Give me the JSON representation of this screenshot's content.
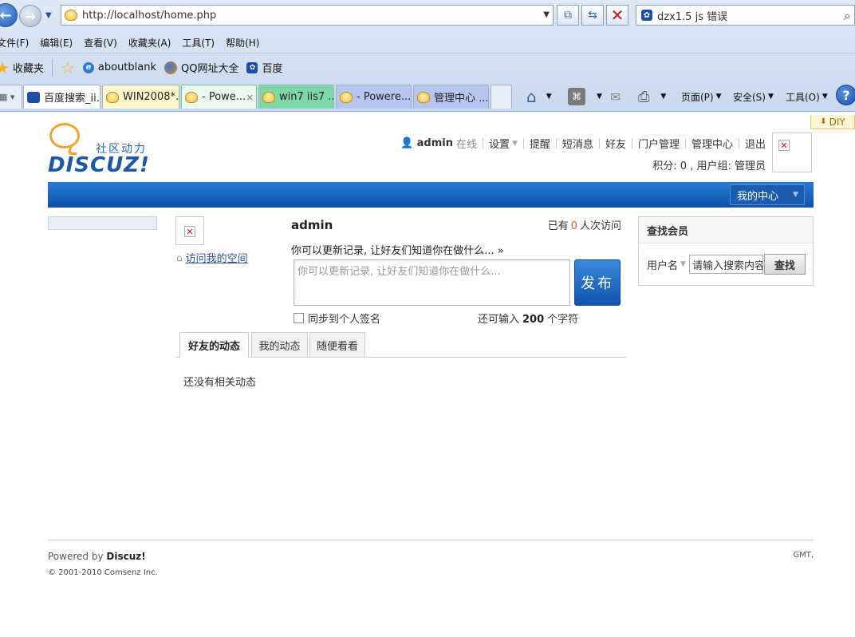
{
  "browser": {
    "address": "http://localhost/home.php",
    "search_text": "dzx1.5 js 错误",
    "menu": [
      "文件(F)",
      "编辑(E)",
      "查看(V)",
      "收藏夹(A)",
      "工具(T)",
      "帮助(H)"
    ],
    "favorites_label": "收藏夹",
    "fav_links": [
      "aboutblank",
      "QQ网址大全",
      "百度"
    ],
    "tabs": [
      "百度搜索_ii...",
      "WIN2008*...",
      "- Powe...",
      "win7 iis7 ...",
      "- Powere...",
      "管理中心 ..."
    ],
    "tab_close": "×",
    "toolbar": {
      "page": "页面(P)",
      "safety": "安全(S)",
      "tools": "工具(O)"
    },
    "colors": {
      "tab_green": "#7fd6a6",
      "tab_blue": "#b6c6ee",
      "tab_yellow": "#fff7cc"
    }
  },
  "site": {
    "diy_label": "DIY",
    "logo_cn": "社区动力",
    "logo_en": "DISCUZ!",
    "user": {
      "name": "admin",
      "online": "在线",
      "links": [
        "设置",
        "提醒",
        "短消息",
        "好友",
        "门户管理",
        "管理中心",
        "退出"
      ],
      "credit_line": "积分: 0 , 用户组: 管理员"
    },
    "nav": {
      "my_center": "我的中心"
    },
    "profile": {
      "visit_space": "访问我的空间",
      "username": "admin",
      "visits_prefix": "已有",
      "visits_count": "0",
      "visits_suffix": "人次访问",
      "prompt": "你可以更新记录, 让好友们知道你在做什么... »",
      "status_placeholder": "你可以更新记录, 让好友们知道你在做什么...",
      "publish": "发布",
      "sync_label": "同步到个人签名",
      "remain_prefix": "还可输入",
      "remain_count": "200",
      "remain_suffix": "个字符"
    },
    "feed_tabs": [
      "好友的动态",
      "我的动态",
      "随便看看"
    ],
    "empty_feed": "还没有相关动态",
    "find_member": {
      "title": "查找会员",
      "field_label": "用户名",
      "placeholder": "请输入搜索内容",
      "button": "查找"
    },
    "footer": {
      "powered_prefix": "Powered by",
      "powered_brand": "Discuz!",
      "copyright": "© 2001-2010 Comsenz Inc.",
      "gmt": "GMT,"
    }
  }
}
